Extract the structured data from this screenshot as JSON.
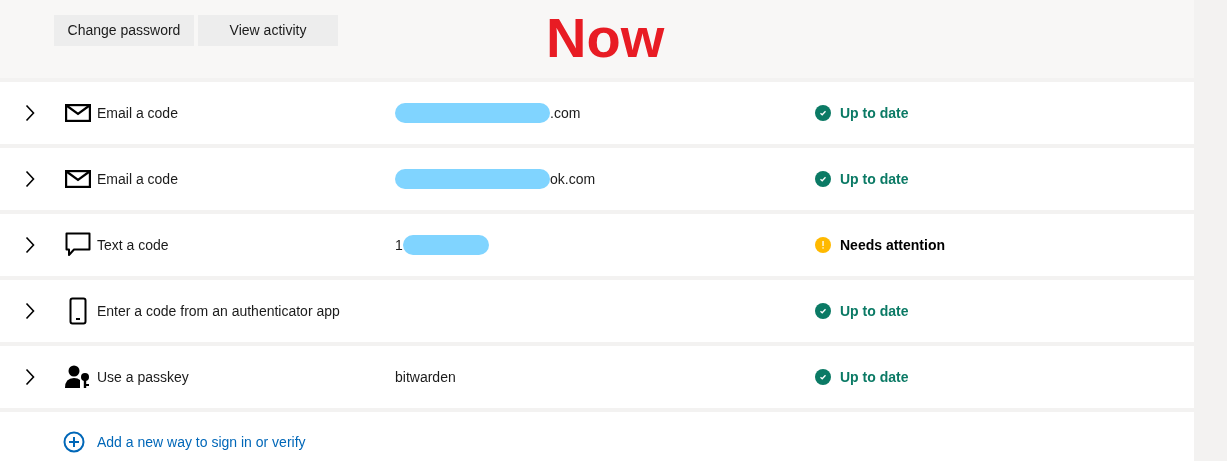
{
  "actions": [
    "Change password",
    "View activity"
  ],
  "annotation": "Now",
  "methods": [
    {
      "kind": "mail",
      "label": "Email a code",
      "detail": [
        {
          "kind": "redacted"
        },
        {
          "kind": "text",
          "text": ".com"
        }
      ],
      "status": {
        "kind": "ok",
        "text": "Up to date"
      }
    },
    {
      "kind": "mail",
      "label": "Email a code",
      "detail": [
        {
          "kind": "redacted"
        },
        {
          "kind": "text",
          "text": "ok.com"
        }
      ],
      "status": {
        "kind": "ok",
        "text": "Up to date"
      }
    },
    {
      "kind": "chat",
      "label": "Text a code",
      "detail": [
        {
          "kind": "text",
          "text": "1"
        },
        {
          "kind": "redacted"
        }
      ],
      "status": {
        "kind": "attention",
        "text": "Needs attention"
      }
    },
    {
      "kind": "phone",
      "label": "Enter a code from an authenticator app",
      "status": {
        "kind": "ok",
        "text": "Up to date"
      }
    },
    {
      "kind": "passkey",
      "label": "Use a passkey",
      "detail": [
        {
          "kind": "text",
          "text": "bitwarden"
        }
      ],
      "status": {
        "kind": "ok",
        "text": "Up to date"
      }
    }
  ],
  "add_link": "Add a new way to sign in or verify"
}
